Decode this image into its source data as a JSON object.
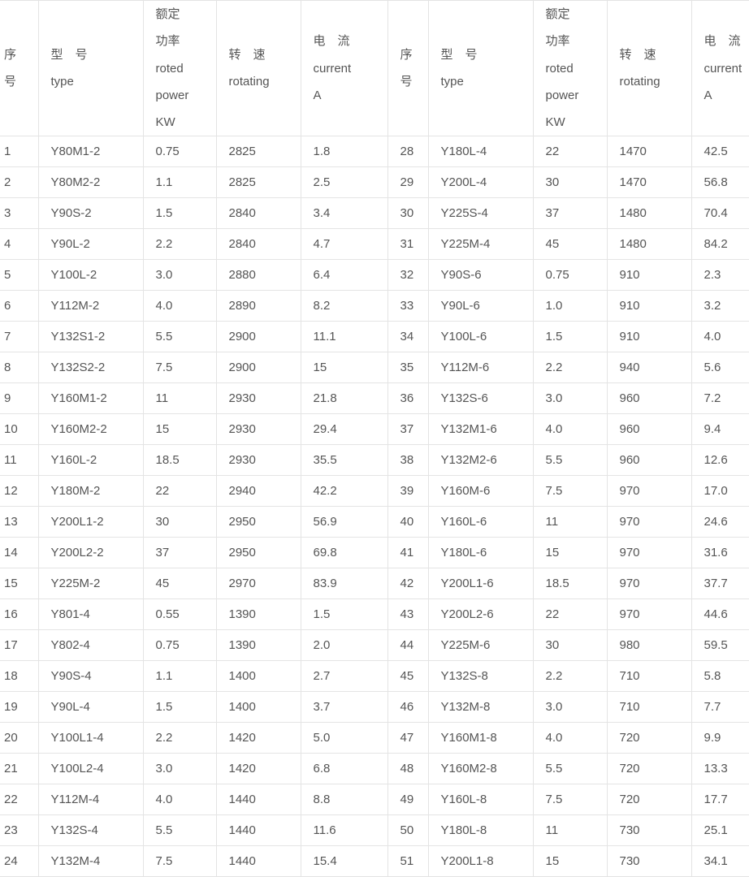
{
  "header": [
    [
      "序",
      "号"
    ],
    [
      "型　号",
      "type"
    ],
    [
      "额定",
      "功率",
      "roted",
      "power",
      "KW"
    ],
    [
      "转　速",
      "rotating"
    ],
    [
      "电　流",
      "current",
      "A"
    ],
    [
      "序",
      "号"
    ],
    [
      "型　号",
      "type"
    ],
    [
      "额定",
      "功率",
      "roted",
      "power",
      "KW"
    ],
    [
      "转　速",
      "rotating"
    ],
    [
      "电　流",
      "current",
      "A"
    ]
  ],
  "rows": [
    [
      "1",
      "Y80M1-2",
      "0.75",
      "2825",
      "1.8",
      "28",
      "Y180L-4",
      "22",
      "1470",
      "42.5"
    ],
    [
      "2",
      "Y80M2-2",
      "1.1",
      "2825",
      "2.5",
      "29",
      "Y200L-4",
      "30",
      "1470",
      "56.8"
    ],
    [
      "3",
      "Y90S-2",
      "1.5",
      "2840",
      "3.4",
      "30",
      "Y225S-4",
      "37",
      "1480",
      "70.4"
    ],
    [
      "4",
      "Y90L-2",
      "2.2",
      "2840",
      "4.7",
      "31",
      "Y225M-4",
      "45",
      "1480",
      "84.2"
    ],
    [
      "5",
      "Y100L-2",
      "3.0",
      "2880",
      "6.4",
      "32",
      "Y90S-6",
      "0.75",
      "910",
      "2.3"
    ],
    [
      "6",
      "Y112M-2",
      "4.0",
      "2890",
      "8.2",
      "33",
      "Y90L-6",
      "1.0",
      "910",
      "3.2"
    ],
    [
      "7",
      "Y132S1-2",
      "5.5",
      "2900",
      "11.1",
      "34",
      "Y100L-6",
      "1.5",
      "910",
      "4.0"
    ],
    [
      "8",
      "Y132S2-2",
      "7.5",
      "2900",
      "15",
      "35",
      "Y112M-6",
      "2.2",
      "940",
      "5.6"
    ],
    [
      "9",
      "Y160M1-2",
      "11",
      "2930",
      "21.8",
      "36",
      "Y132S-6",
      "3.0",
      "960",
      "7.2"
    ],
    [
      "10",
      "Y160M2-2",
      "15",
      "2930",
      "29.4",
      "37",
      "Y132M1-6",
      "4.0",
      "960",
      "9.4"
    ],
    [
      "11",
      "Y160L-2",
      "18.5",
      "2930",
      "35.5",
      "38",
      "Y132M2-6",
      "5.5",
      "960",
      "12.6"
    ],
    [
      "12",
      "Y180M-2",
      "22",
      "2940",
      "42.2",
      "39",
      "Y160M-6",
      "7.5",
      "970",
      "17.0"
    ],
    [
      "13",
      "Y200L1-2",
      "30",
      "2950",
      "56.9",
      "40",
      "Y160L-6",
      "11",
      "970",
      "24.6"
    ],
    [
      "14",
      "Y200L2-2",
      "37",
      "2950",
      "69.8",
      "41",
      "Y180L-6",
      "15",
      "970",
      "31.6"
    ],
    [
      "15",
      "Y225M-2",
      "45",
      "2970",
      "83.9",
      "42",
      "Y200L1-6",
      "18.5",
      "970",
      "37.7"
    ],
    [
      "16",
      "Y801-4",
      "0.55",
      "1390",
      "1.5",
      "43",
      "Y200L2-6",
      "22",
      "970",
      "44.6"
    ],
    [
      "17",
      "Y802-4",
      "0.75",
      "1390",
      "2.0",
      "44",
      "Y225M-6",
      "30",
      "980",
      "59.5"
    ],
    [
      "18",
      "Y90S-4",
      "1.1",
      "1400",
      "2.7",
      "45",
      "Y132S-8",
      "2.2",
      "710",
      "5.8"
    ],
    [
      "19",
      "Y90L-4",
      "1.5",
      "1400",
      "3.7",
      "46",
      "Y132M-8",
      "3.0",
      "710",
      "7.7"
    ],
    [
      "20",
      "Y100L1-4",
      "2.2",
      "1420",
      "5.0",
      "47",
      "Y160M1-8",
      "4.0",
      "720",
      "9.9"
    ],
    [
      "21",
      "Y100L2-4",
      "3.0",
      "1420",
      "6.8",
      "48",
      "Y160M2-8",
      "5.5",
      "720",
      "13.3"
    ],
    [
      "22",
      "Y112M-4",
      "4.0",
      "1440",
      "8.8",
      "49",
      "Y160L-8",
      "7.5",
      "720",
      "17.7"
    ],
    [
      "23",
      "Y132S-4",
      "5.5",
      "1440",
      "11.6",
      "50",
      "Y180L-8",
      "11",
      "730",
      "25.1"
    ],
    [
      "24",
      "Y132M-4",
      "7.5",
      "1440",
      "15.4",
      "51",
      "Y200L1-8",
      "15",
      "730",
      "34.1"
    ]
  ]
}
